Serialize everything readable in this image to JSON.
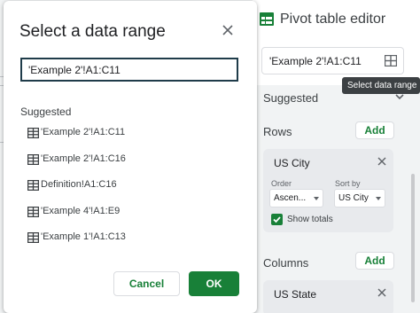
{
  "dialog": {
    "title": "Select a data range",
    "close_icon": "close-icon",
    "range_input_value": "'Example 2'!A1:C11",
    "suggested_heading": "Suggested",
    "suggestions": [
      {
        "label": "'Example 2'!A1:C11",
        "icon": "grid-icon"
      },
      {
        "label": "'Example 2'!A1:C16",
        "icon": "grid-icon"
      },
      {
        "label": "Definition!A1:C16",
        "icon": "grid-icon"
      },
      {
        "label": "'Example 4'!A1:E9",
        "icon": "grid-icon"
      },
      {
        "label": "'Example 1'!A1:C13",
        "icon": "grid-icon"
      }
    ],
    "cancel_label": "Cancel",
    "ok_label": "OK"
  },
  "pivot_editor": {
    "title": "Pivot table editor",
    "title_icon": "pivot-table-icon",
    "range_value": "'Example 2'!A1:C11",
    "range_icon": "grid-icon",
    "tooltip": "Select data range",
    "suggested_label": "Suggested",
    "rows_label": "Rows",
    "rows_add_label": "Add",
    "rows_field": {
      "name": "US City",
      "order_label": "Order",
      "order_value": "Ascen...",
      "sort_label": "Sort by",
      "sort_value": "US City",
      "show_totals_label": "Show totals",
      "show_totals_checked": true
    },
    "columns_label": "Columns",
    "columns_add_label": "Add",
    "columns_field": {
      "name": "US State"
    }
  },
  "colors": {
    "accent_green": "#188038",
    "panel_bg": "#f1f3f4",
    "input_border": "#1f3c4a",
    "tooltip_bg": "#3c4043"
  }
}
